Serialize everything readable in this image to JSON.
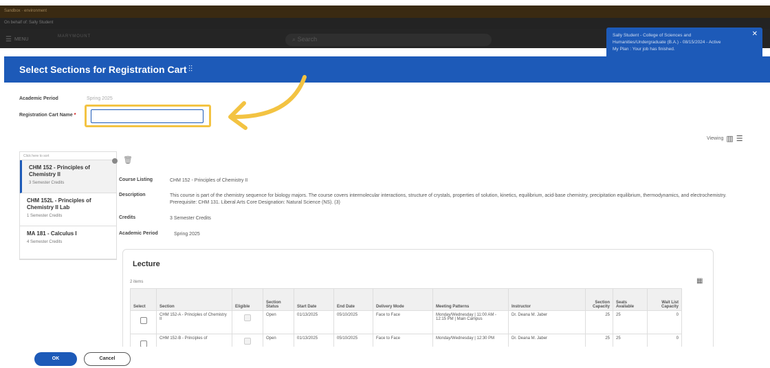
{
  "top_bars": {
    "sandbox": "Sandbox · environment",
    "behalf": "On behalf of: Sally Student"
  },
  "header": {
    "menu_label": "MENU",
    "logo_text": "MARYMOUNT",
    "search_placeholder": "Search"
  },
  "notification": {
    "line1": "Sally Student - College of Sciences and",
    "line2": "Humanities/Undergraduate (B.A.) - 08/15/2024 - Active",
    "line3": "My Plan : Your job has finished."
  },
  "modal": {
    "title": "Select Sections for Registration Cart",
    "academic_period_label": "Academic Period",
    "academic_period_value": "Spring 2025",
    "cart_name_label": "Registration Cart Name",
    "cart_name_value": ""
  },
  "viewing_label": "Viewing",
  "sort_panel": {
    "header": "Click here to sort",
    "courses": [
      {
        "name": "CHM 152 - Principles of Chemistry II",
        "credits": "3 Semester Credits"
      },
      {
        "name": "CHM 152L - Principles of Chemistry II Lab",
        "credits": "1 Semester Credits"
      },
      {
        "name": "MA 181 - Calculus I",
        "credits": "4 Semester Credits"
      }
    ]
  },
  "details": {
    "course_listing_label": "Course Listing",
    "course_listing_value": "CHM 152 - Principles of Chemistry II",
    "description_label": "Description",
    "description_value": "This course is part of the chemistry sequence for biology majors. The course covers intermolecular interactions, structure of crystals, properties of solution, kinetics, equilibrium, acid-base chemistry, precipitation equilibrium, thermodynamics, and electrochemistry. Prerequisite: CHM 131. Liberal Arts Core Designation: Natural Science (NS). (3)",
    "credits_label": "Credits",
    "credits_value": "3 Semester Credits",
    "period_label": "Academic Period",
    "period_value": "Spring 2025"
  },
  "lecture": {
    "title": "Lecture",
    "items_count": "2 items",
    "columns": [
      "Select",
      "Section",
      "Eligible",
      "Section Status",
      "Start Date",
      "End Date",
      "Delivery Mode",
      "Meeting Patterns",
      "Instructor",
      "Section Capacity",
      "Seats Available",
      "Wait List Capacity"
    ],
    "rows": [
      {
        "section": "CHM 152-A - Principles of Chemistry II",
        "status": "Open",
        "start": "01/13/2025",
        "end": "05/10/2025",
        "mode": "Face to Face",
        "meeting": "Monday/Wednesday | 11:00 AM - 12:15 PM | Main Campus",
        "instructor": "Dr. Deana M. Jaber",
        "capacity": "25",
        "seats": "25",
        "waitlist": "0"
      },
      {
        "section": "CHM 152-B - Principles of",
        "status": "Open",
        "start": "01/13/2025",
        "end": "05/10/2025",
        "mode": "Face to Face",
        "meeting": "Monday/Wednesday | 12:30 PM",
        "instructor": "Dr. Deana M. Jaber",
        "capacity": "25",
        "seats": "25",
        "waitlist": "0"
      }
    ]
  },
  "footer": {
    "ok_label": "OK",
    "cancel_label": "Cancel"
  },
  "colors": {
    "primary": "#1d5ab8",
    "highlight": "#f3c342"
  }
}
